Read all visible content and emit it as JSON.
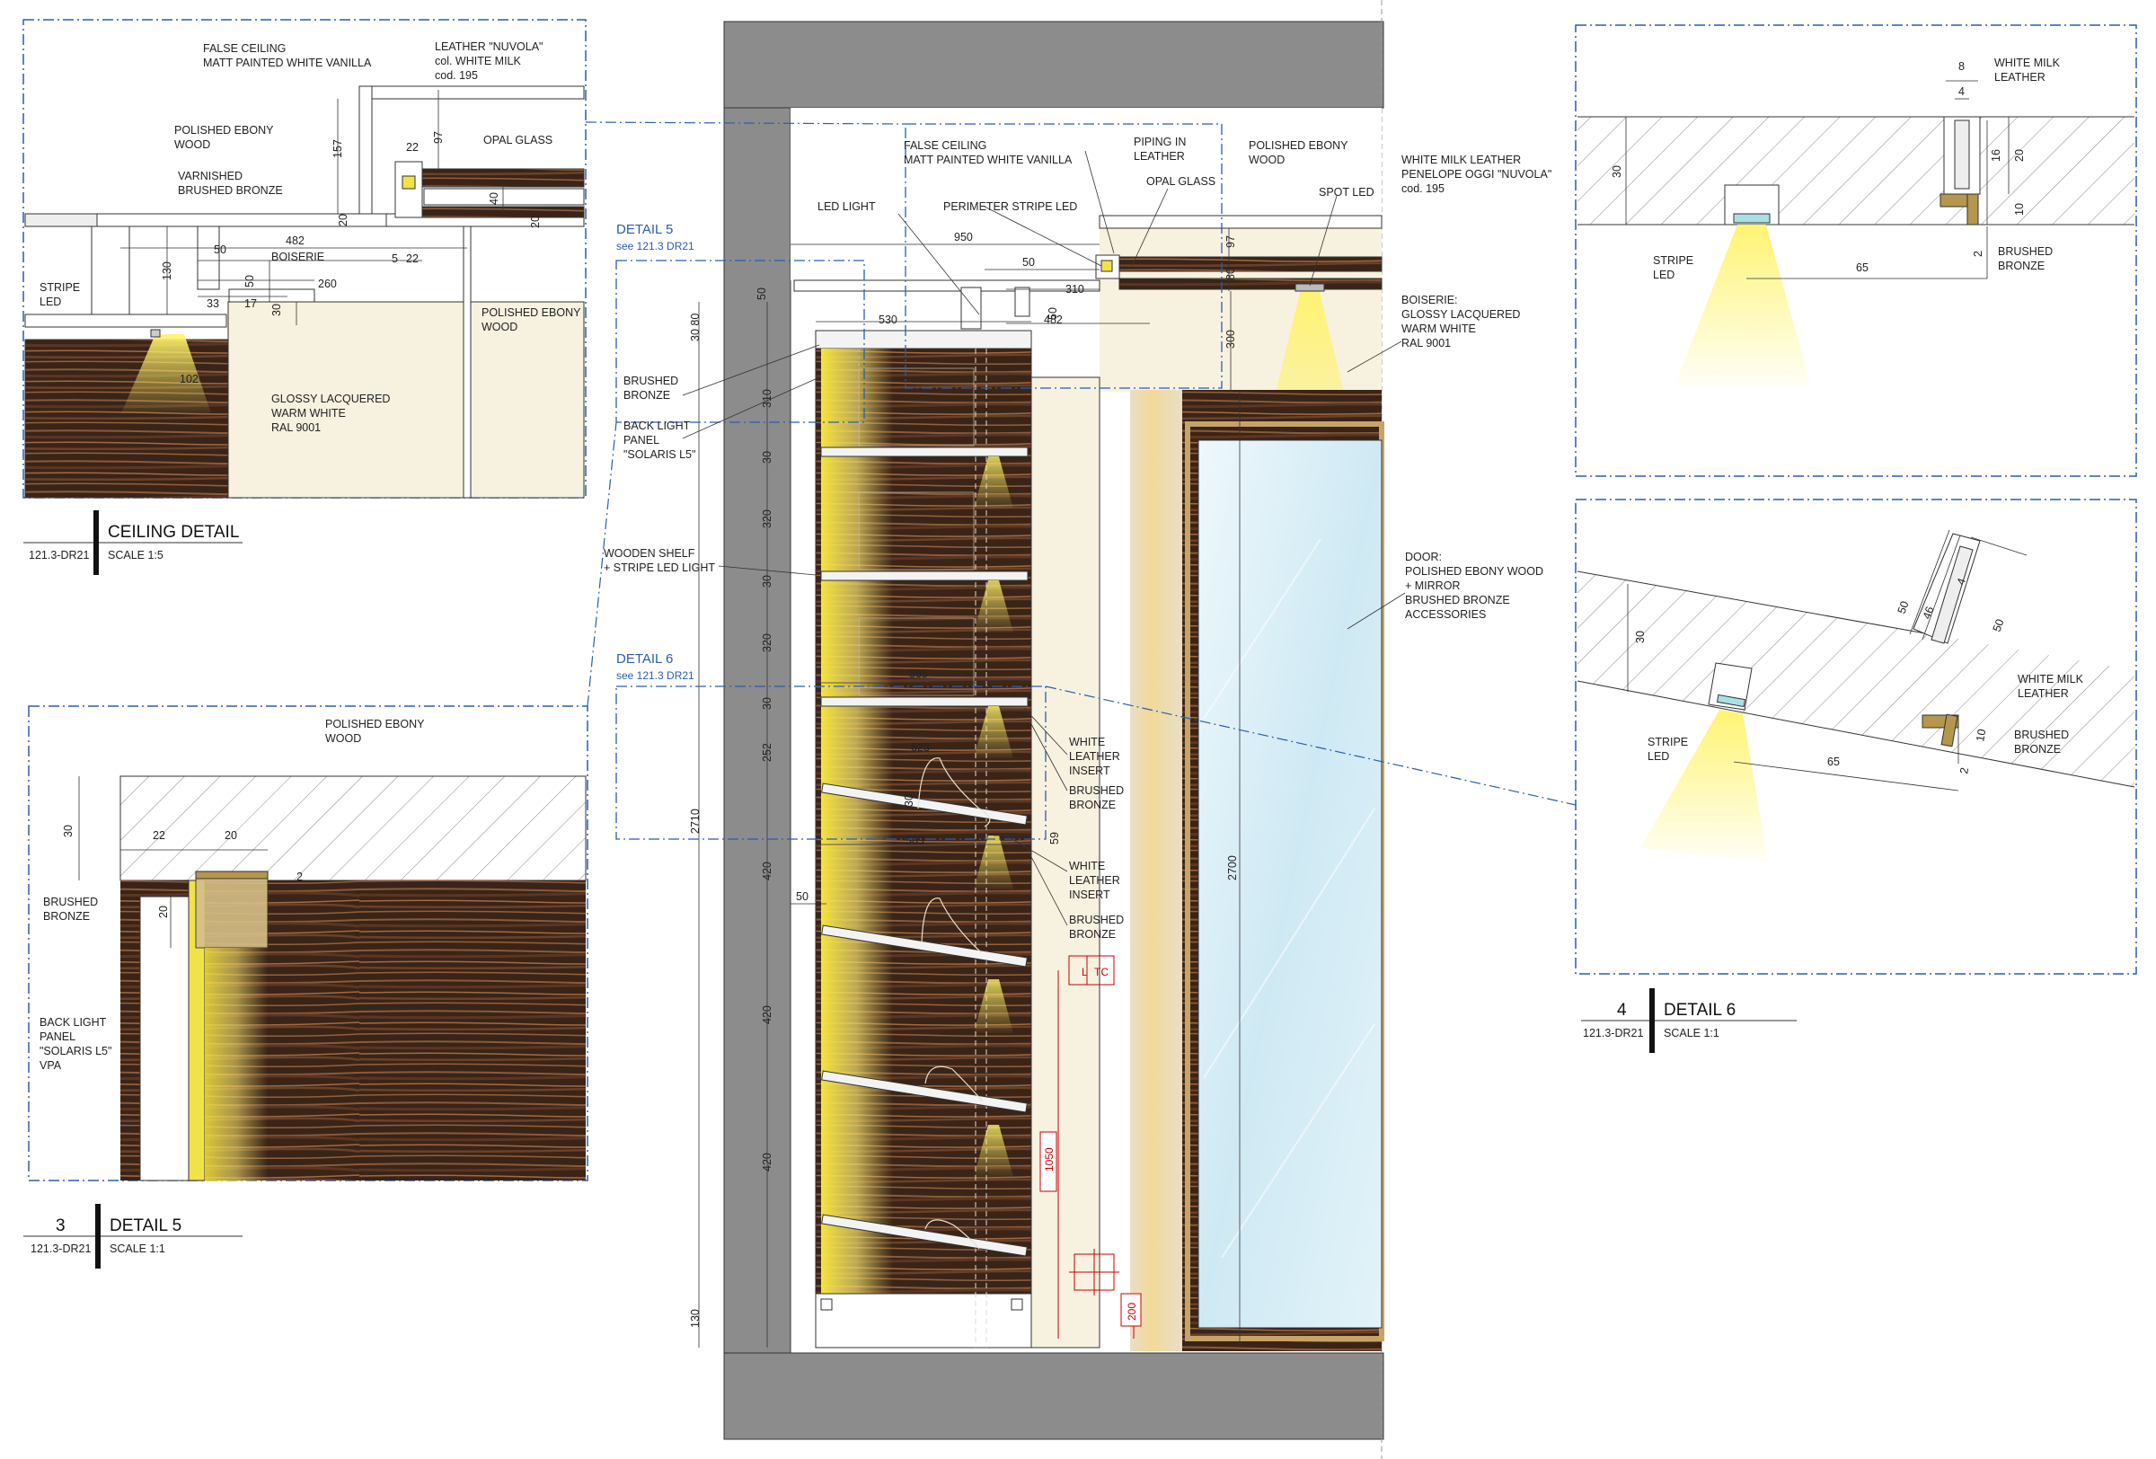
{
  "colors": {
    "ebony_dark": "#3a2417",
    "ebony_light": "#8a5a3a",
    "wall_grey": "#8c8c8c",
    "cream": "#f7f1df",
    "led_yellow": "#f2e24a",
    "bronze": "#b5964e",
    "detail_blue": "#2a5db0",
    "mirror": "#d8eef6",
    "frame": "#c6a467"
  },
  "ceiling_detail": {
    "title": "CEILING DETAIL",
    "ref": "121.3-DR21",
    "scale": "SCALE 1:5",
    "labels": {
      "false_ceiling_1": "FALSE CEILING",
      "false_ceiling_2": "MATT PAINTED WHITE VANILLA",
      "leather_1": "LEATHER \"NUVOLA\"",
      "leather_2": "col. WHITE MILK",
      "leather_3": "cod. 195",
      "polished_ebony_1": "POLISHED EBONY",
      "polished_ebony_2": "WOOD",
      "varnished_1": "VARNISHED",
      "varnished_2": "BRUSHED BRONZE",
      "opal_glass": "OPAL GLASS",
      "boiserie": "BOISERIE",
      "stripe_1": "STRIPE",
      "stripe_2": "LED",
      "polished_ebony_b1": "POLISHED EBONY",
      "polished_ebony_b2": "WOOD",
      "glossy_1": "GLOSSY LACQUERED",
      "glossy_2": "WARM WHITE",
      "glossy_3": "RAL 9001"
    },
    "dims": {
      "d157": "157",
      "d97": "97",
      "d22a": "22",
      "d20a": "20",
      "d40": "40",
      "d20b": "20",
      "d482": "482",
      "d50a": "50",
      "d5": "5",
      "d22b": "22",
      "d130": "130",
      "d50b": "50",
      "d260": "260",
      "d33": "33",
      "d17": "17",
      "d30": "30",
      "d102": "102"
    }
  },
  "detail5": {
    "number": "3",
    "title": "DETAIL 5",
    "ref": "121.3-DR21",
    "scale": "SCALE 1:1",
    "tag": "DETAIL 5",
    "tag_ref": "see 121.3 DR21",
    "labels": {
      "polished_1": "POLISHED EBONY",
      "polished_2": "WOOD",
      "bronze_1": "BRUSHED",
      "bronze_2": "BRONZE",
      "back_1": "BACK LIGHT",
      "back_2": "PANEL",
      "back_3": "\"SOLARIS L5\"",
      "back_4": "VPA"
    },
    "dims": {
      "d30": "30",
      "d22": "22",
      "d20a": "20",
      "d2": "2",
      "d20b": "20"
    }
  },
  "detail6": {
    "number": "4",
    "title": "DETAIL 6",
    "ref": "121.3-DR21",
    "scale": "SCALE 1:1",
    "tag": "DETAIL 6",
    "tag_ref": "see 121.3 DR21",
    "top_labels": {
      "milk_1": "WHITE MILK",
      "milk_2": "LEATHER",
      "stripe_1": "STRIPE",
      "stripe_2": "LED",
      "bronze_1": "BRUSHED",
      "bronze_2": "BRONZE"
    },
    "top_dims": {
      "d8": "8",
      "d4": "4",
      "d16": "16",
      "d20": "20",
      "d30": "30",
      "d10": "10",
      "d2": "2",
      "d65": "65"
    },
    "bot_labels": {
      "milk_1": "WHITE MILK",
      "milk_2": "LEATHER",
      "stripe_1": "STRIPE",
      "stripe_2": "LED",
      "bronze_1": "BRUSHED",
      "bronze_2": "BRONZE"
    },
    "bot_dims": {
      "d30": "30",
      "d50a": "50",
      "d46": "46",
      "d4": "4",
      "d50b": "50",
      "d10": "10",
      "d2": "2",
      "d65": "65"
    }
  },
  "elevation": {
    "labels": {
      "false_1": "FALSE CEILING",
      "false_2": "MATT PAINTED WHITE VANILLA",
      "piping_1": "PIPING IN",
      "piping_2": "LEATHER",
      "polished_1": "POLISHED EBONY",
      "polished_2": "WOOD",
      "milk_1": "WHITE MILK LEATHER",
      "milk_2": "PENELOPE OGGI \"NUVOLA\"",
      "milk_3": "cod. 195",
      "led_light": "LED LIGHT",
      "perimeter": "PERIMETER STRIPE LED",
      "opal": "OPAL GLASS",
      "spot": "SPOT LED",
      "bois_1": "BOISERIE:",
      "bois_2": "GLOSSY LACQUERED",
      "bois_3": "WARM WHITE",
      "bois_4": "RAL 9001",
      "brushed_1": "BRUSHED",
      "brushed_2": "BRONZE",
      "back_1": "BACK LIGHT",
      "back_2": "PANEL",
      "back_3": "\"SOLARIS L5\"",
      "shelf_1": "WOODEN SHELF",
      "shelf_2": "+ STRIPE LED LIGHT",
      "door_1": "DOOR:",
      "door_2": "POLISHED EBONY WOOD",
      "door_3": "+ MIRROR",
      "door_4": "BRUSHED BRONZE",
      "door_5": "ACCESSORIES",
      "wl_1": "WHITE",
      "wl_2": "LEATHER",
      "wl_3": "INSERT",
      "bb_1": "BRUSHED",
      "bb_2": "BRONZE",
      "wl2_1": "WHITE",
      "wl2_2": "LEATHER",
      "wl2_3": "INSERT",
      "bb2_1": "BRUSHED",
      "bb2_2": "BRONZE",
      "l_tag": "L",
      "tc_tag": "TC"
    },
    "dims": {
      "d950": "950",
      "d50a": "50",
      "d310": "310",
      "d50b": "50",
      "d482": "482",
      "d530": "530",
      "d97": "97",
      "d80": "80",
      "d300": "300",
      "d50c": "50",
      "d3080": "30 80",
      "d310v": "310",
      "d30a": "30",
      "d320a": "320",
      "d30b": "30",
      "d320b": "320",
      "d30c": "30",
      "d252": "252",
      "d2710": "2710",
      "d420a": "420",
      "d420b": "420",
      "d420c": "420",
      "d130": "130",
      "d565": "565",
      "d623": "623",
      "d30s": "30",
      "d563": "563",
      "d59": "59",
      "d50d": "50",
      "d2700": "2700",
      "d1050": "1050",
      "d200": "200"
    }
  }
}
